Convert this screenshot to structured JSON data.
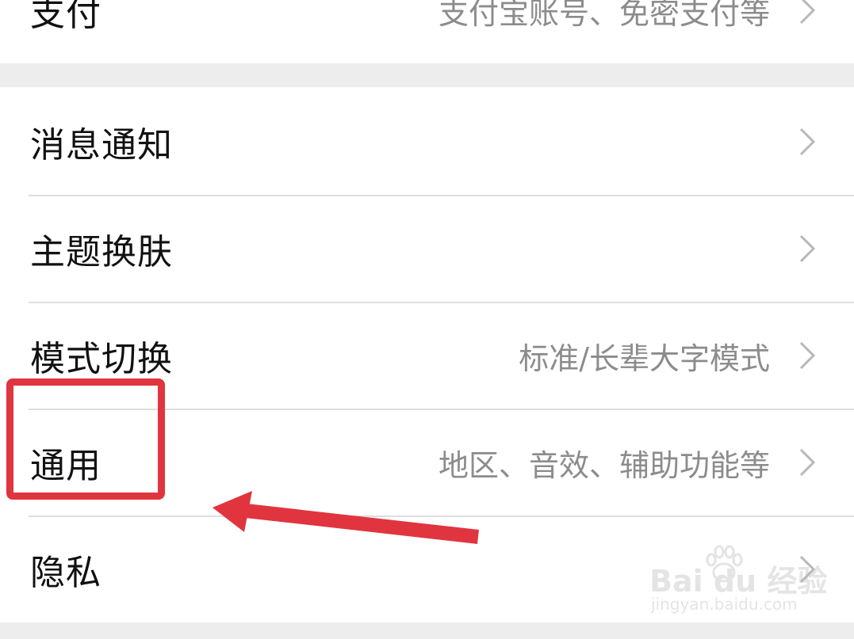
{
  "settings": {
    "top_item": {
      "label": "支付",
      "value": "支付宝账号、免密支付等"
    },
    "items": [
      {
        "label": "消息通知",
        "value": ""
      },
      {
        "label": "主题换肤",
        "value": ""
      },
      {
        "label": "模式切换",
        "value": "标准/长辈大字模式"
      },
      {
        "label": "通用",
        "value": "地区、音效、辅助功能等"
      },
      {
        "label": "隐私",
        "value": ""
      }
    ]
  },
  "annotation": {
    "highlight_color": "#e0353f",
    "highlighted_item": "通用"
  },
  "watermark": {
    "main": "Bai du 经验",
    "sub": "jingyan.baidu.com"
  },
  "colors": {
    "background": "#ededed",
    "card": "#ffffff",
    "label": "#111111",
    "value": "#8c8c8c",
    "divider": "#dedede"
  }
}
